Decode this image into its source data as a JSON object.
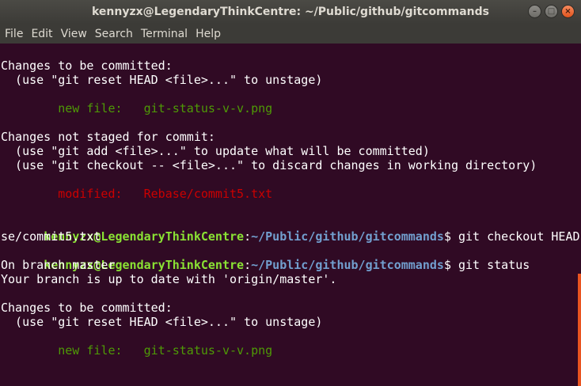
{
  "window": {
    "title": "kennyzx@LegendaryThinkCentre: ~/Public/github/gitcommands",
    "minimize_glyph": "–",
    "maximize_glyph": "□",
    "close_glyph": "×"
  },
  "menu": {
    "file": "File",
    "edit": "Edit",
    "view": "View",
    "search": "Search",
    "terminal": "Terminal",
    "help": "Help"
  },
  "prompt": {
    "user_host": "kennyzx@LegendaryThinkCentre",
    "colon": ":",
    "path": "~/Public/github/gitcommands",
    "dollar": "$ "
  },
  "output": {
    "l1": "Changes to be committed:",
    "l2": "  (use \"git reset HEAD <file>...\" to unstage)",
    "l3": "        new file:   git-status-v-v.png",
    "l4": "Changes not staged for commit:",
    "l5": "  (use \"git add <file>...\" to update what will be committed)",
    "l6": "  (use \"git checkout -- <file>...\" to discard changes in working directory)",
    "l7": "        modified:   Rebase/commit5.txt",
    "cmd1": "git checkout HEAD Reba",
    "cmd1_wrap": "se/commit5.txt",
    "cmd2": "git status",
    "l8": "On branch master",
    "l9": "Your branch is up to date with 'origin/master'.",
    "l10": "Changes to be committed:",
    "l11": "  (use \"git reset HEAD <file>...\" to unstage)",
    "l12": "        new file:   git-status-v-v.png"
  },
  "colors": {
    "background": "#300a24",
    "prompt_user": "#8ae234",
    "prompt_path": "#729fcf",
    "staged": "#4e9a06",
    "unstaged": "#cc0000",
    "scrollbar": "#e95420"
  }
}
